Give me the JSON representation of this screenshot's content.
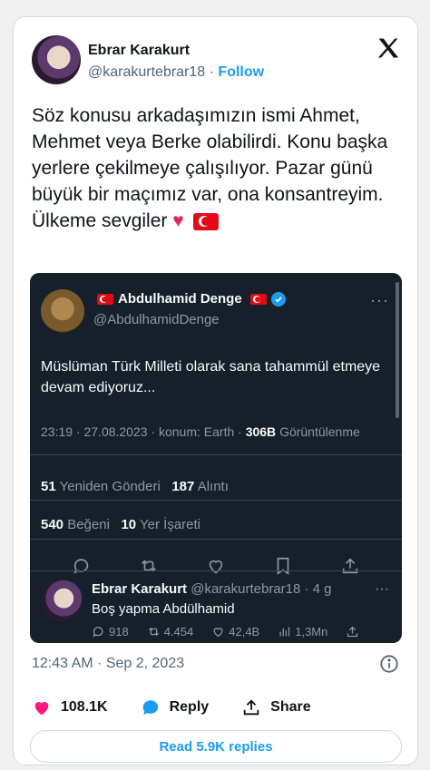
{
  "author": {
    "name": "Ebrar Karakurt",
    "handle": "@karakurtebrar18",
    "separator": "·",
    "follow_label": "Follow"
  },
  "tweet": {
    "text": "Söz konusu arkadaşımızın ismi Ahmet, Mehmet veya Berke olabilirdi. Konu başka yerlere çekilmeye çalışılıyor. Pazar günü büyük bir maçımız var, ona konsantreyim. Ülkeme sevgiler",
    "heart_emoji": "♥"
  },
  "quoted": {
    "name": "Abdulhamid Denge",
    "handle": "@AbdulhamidDenge",
    "text": "Müslüman Türk Milleti olarak sana tahammül etmeye devam ediyoruz...",
    "meta_prefix": "23:19 · 27.08.2023 · konum: Earth ·",
    "views_count": "306B",
    "views_label": "Görüntülenme",
    "retweets_count": "51",
    "retweets_label": "Yeniden Gönderi",
    "quotes_count": "187",
    "quotes_label": "Alıntı",
    "likes_count": "540",
    "likes_label": "Beğeni",
    "bookmarks_count": "10",
    "bookmarks_label": "Yer İşareti",
    "dots": "···"
  },
  "reply": {
    "name": "Ebrar Karakurt",
    "handle_time": "@karakurtebrar18 · 4 g",
    "text": "Boş yapma Abdülhamid",
    "replies": "918",
    "retweets": "4.454",
    "likes": "42,4B",
    "views": "1,3Mn",
    "dots": "···"
  },
  "timestamp": "12:43 AM · Sep 2, 2023",
  "footer": {
    "likes": "108.1K",
    "reply_label": "Reply",
    "share_label": "Share",
    "read_replies_label": "Read 5.9K replies"
  },
  "colors": {
    "accent": "#1d9bf0",
    "like": "#f91880",
    "embed_bg": "#15202b"
  }
}
